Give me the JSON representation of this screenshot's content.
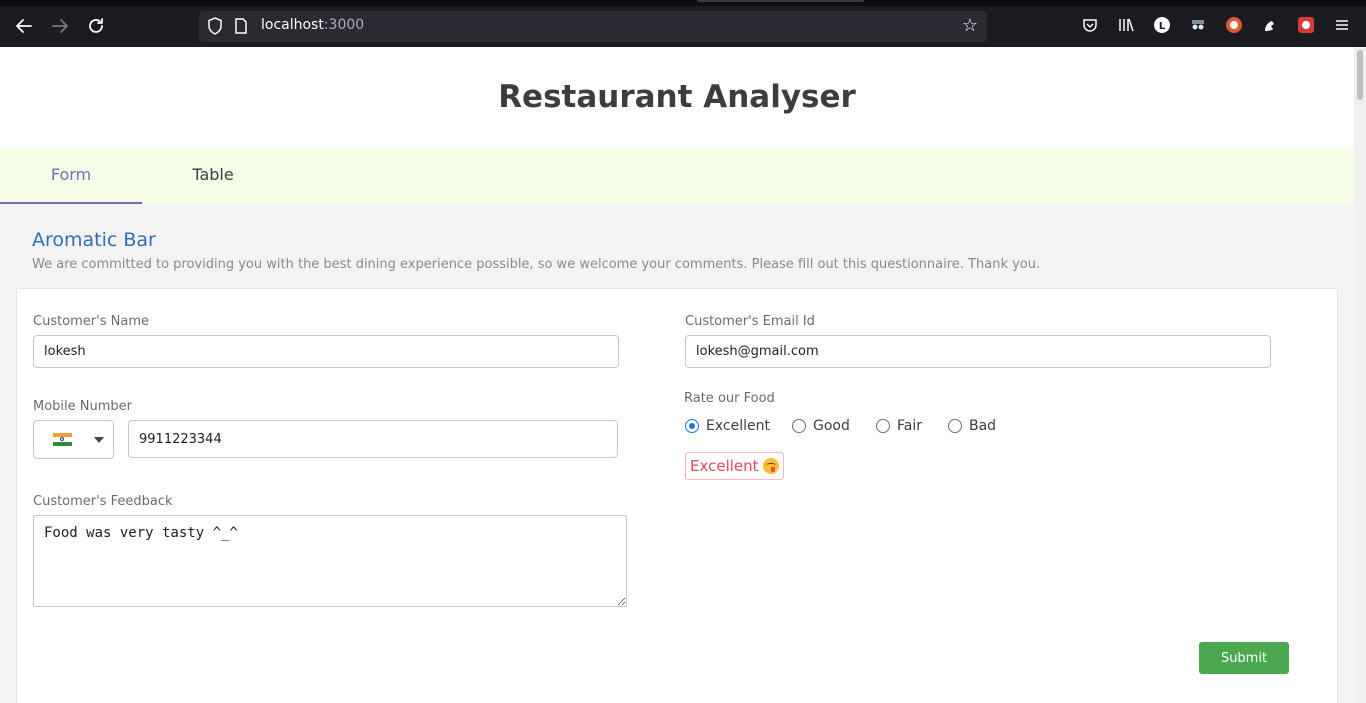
{
  "browser": {
    "url_host": "localhost",
    "url_port": ":3000"
  },
  "app": {
    "title": "Restaurant Analyser"
  },
  "tabs": [
    {
      "label": "Form",
      "active": true
    },
    {
      "label": "Table",
      "active": false
    }
  ],
  "restaurant": {
    "name": "Aromatic Bar",
    "intro": "We are committed to providing you with the best dining experience possible, so we welcome your comments. Please fill out this questionnaire. Thank you."
  },
  "form": {
    "name_label": "Customer's Name",
    "name_value": "lokesh",
    "email_label": "Customer's Email Id",
    "email_value": "lokesh@gmail.com",
    "mobile_label": "Mobile Number",
    "mobile_value": "9911223344",
    "country_flag": "india-flag-icon",
    "feedback_label": "Customer's Feedback",
    "feedback_value": "Food was very tasty ^_^",
    "rate_label": "Rate our Food",
    "rate_options": [
      {
        "label": "Excellent",
        "checked": true
      },
      {
        "label": "Good",
        "checked": false
      },
      {
        "label": "Fair",
        "checked": false
      },
      {
        "label": "Bad",
        "checked": false
      }
    ],
    "rating_tag": "Excellent",
    "submit_label": "Submit"
  },
  "colors": {
    "tab_active": "#7b6db5",
    "tabbar_bg": "#f5fde6",
    "heading_blue": "#2e6eb8",
    "submit_green": "#4aa851",
    "tag_red": "#e8455d",
    "radio_blue": "#1a73e8"
  }
}
